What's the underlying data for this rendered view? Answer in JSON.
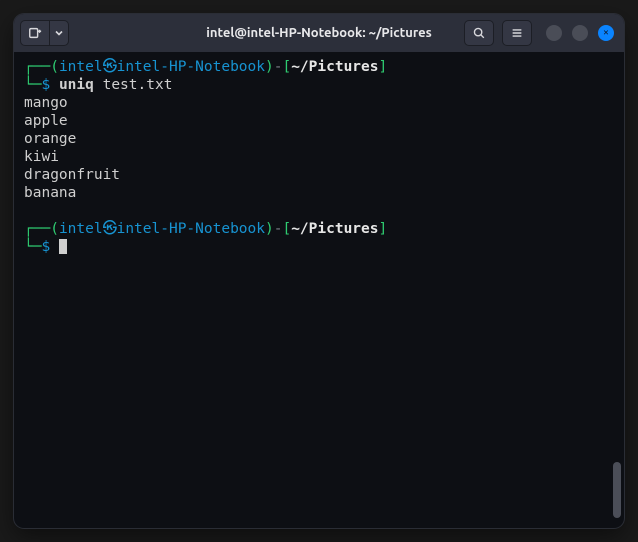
{
  "window": {
    "title": "intel@intel-HP-Notebook: ~/Pictures"
  },
  "prompt": {
    "open_corner": "┌──",
    "paren_open": "(",
    "user": "intel",
    "skull": "㉿",
    "host": "intel-HP-Notebook",
    "paren_close": ")",
    "dash": "-",
    "bracket_open": "[",
    "cwd": "~/Pictures",
    "bracket_close": "]",
    "line2_corner": "└─",
    "sigil": "$"
  },
  "command": {
    "name": "uniq",
    "arg": "test.txt"
  },
  "output": [
    "mango",
    "apple",
    "orange",
    "kiwi",
    "dragonfruit",
    "banana"
  ]
}
